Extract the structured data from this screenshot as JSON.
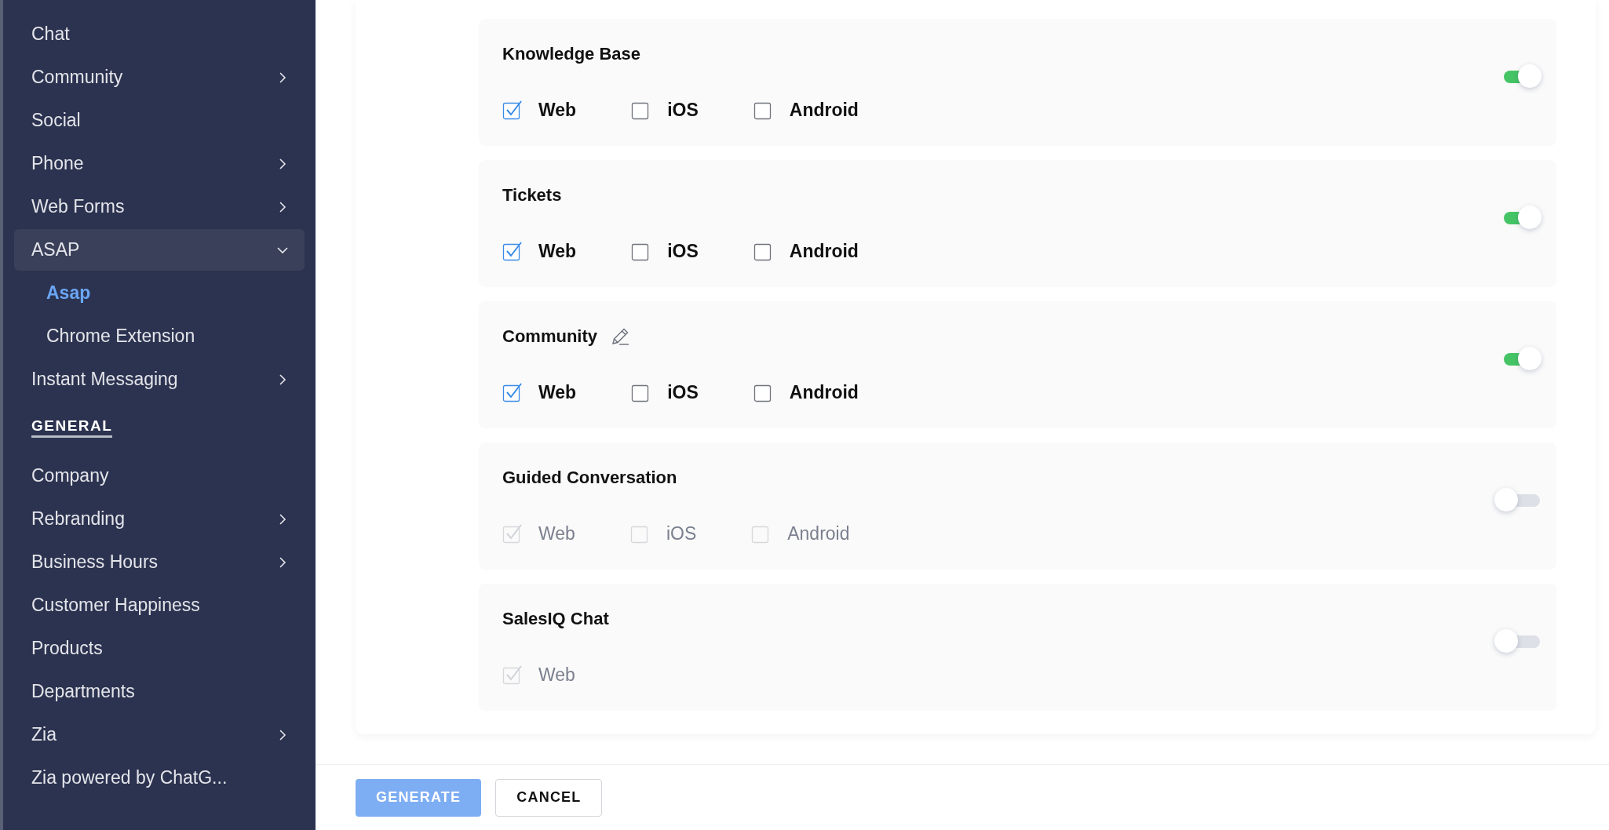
{
  "sidebar": {
    "items": [
      {
        "kind": "item",
        "label": "Chat",
        "selected": false
      },
      {
        "kind": "item",
        "label": "Community",
        "expanded": false,
        "selected": false
      },
      {
        "kind": "item",
        "label": "Social",
        "selected": false
      },
      {
        "kind": "item",
        "label": "Phone",
        "expanded": false,
        "selected": false
      },
      {
        "kind": "item",
        "label": "Web Forms",
        "expanded": false,
        "selected": false
      },
      {
        "kind": "item",
        "label": "ASAP",
        "expanded": true,
        "selected": false,
        "children": [
          {
            "label": "Asap",
            "selected": true
          },
          {
            "label": "Chrome Extension",
            "selected": false
          }
        ]
      },
      {
        "kind": "item",
        "label": "Instant Messaging",
        "expanded": false,
        "selected": false
      },
      {
        "kind": "heading",
        "label": "GENERAL"
      },
      {
        "kind": "item",
        "label": "Company",
        "selected": false
      },
      {
        "kind": "item",
        "label": "Rebranding",
        "expanded": false,
        "selected": false
      },
      {
        "kind": "item",
        "label": "Business Hours",
        "expanded": false,
        "selected": false
      },
      {
        "kind": "item",
        "label": "Customer Happiness",
        "selected": false
      },
      {
        "kind": "item",
        "label": "Products",
        "selected": false
      },
      {
        "kind": "item",
        "label": "Departments",
        "selected": false
      },
      {
        "kind": "item",
        "label": "Zia",
        "expanded": false,
        "selected": false
      },
      {
        "kind": "item",
        "label": "Zia powered by ChatG...",
        "selected": false
      }
    ]
  },
  "sections": [
    {
      "title": "Knowledge Base",
      "editable": false,
      "enabled": true,
      "options": [
        {
          "label": "Web",
          "checked": true
        },
        {
          "label": "iOS",
          "checked": false
        },
        {
          "label": "Android",
          "checked": false
        }
      ]
    },
    {
      "title": "Tickets",
      "editable": false,
      "enabled": true,
      "options": [
        {
          "label": "Web",
          "checked": true
        },
        {
          "label": "iOS",
          "checked": false
        },
        {
          "label": "Android",
          "checked": false
        }
      ]
    },
    {
      "title": "Community",
      "editable": true,
      "enabled": true,
      "options": [
        {
          "label": "Web",
          "checked": true
        },
        {
          "label": "iOS",
          "checked": false
        },
        {
          "label": "Android",
          "checked": false
        }
      ]
    },
    {
      "title": "Guided Conversation",
      "editable": false,
      "enabled": false,
      "options": [
        {
          "label": "Web",
          "checked": true
        },
        {
          "label": "iOS",
          "checked": false
        },
        {
          "label": "Android",
          "checked": false
        }
      ]
    },
    {
      "title": "SalesIQ Chat",
      "editable": false,
      "enabled": false,
      "options": [
        {
          "label": "Web",
          "checked": true
        }
      ]
    }
  ],
  "footer": {
    "buttons": [
      {
        "label": "GENERATE",
        "kind": "primary"
      },
      {
        "label": "CANCEL",
        "kind": "secondary"
      }
    ]
  }
}
